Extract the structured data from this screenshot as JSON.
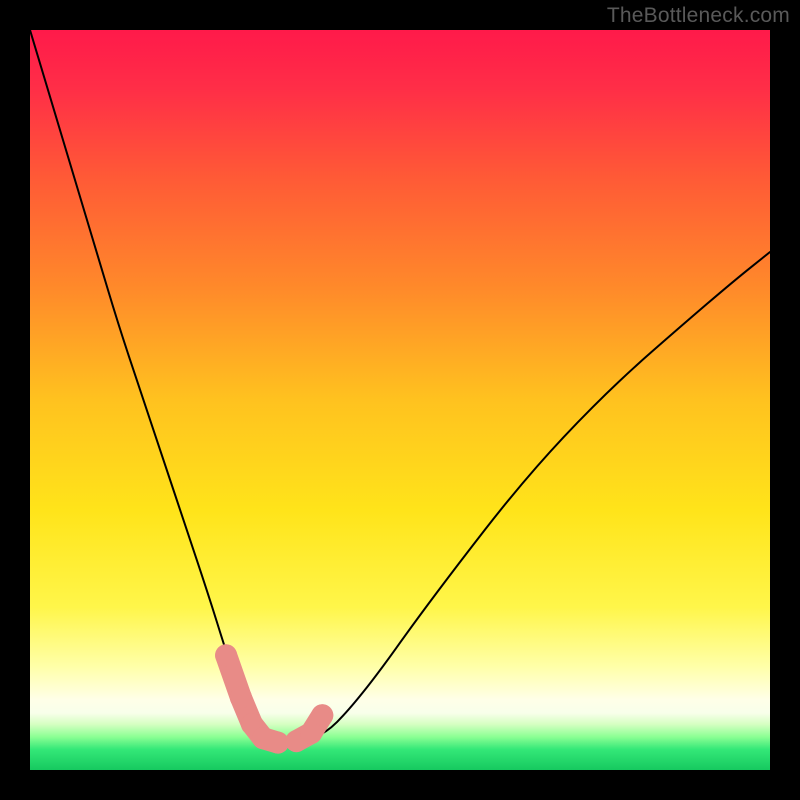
{
  "watermark": "TheBottleneck.com",
  "colors": {
    "frame": "#000000",
    "curve": "#000000",
    "marker_fill": "#e88b87",
    "marker_stroke": "#c76d69",
    "gradient_stops": [
      {
        "offset": 0.0,
        "color": "#ff1a4a"
      },
      {
        "offset": 0.08,
        "color": "#ff2e47"
      },
      {
        "offset": 0.2,
        "color": "#ff5a36"
      },
      {
        "offset": 0.35,
        "color": "#ff8a2a"
      },
      {
        "offset": 0.5,
        "color": "#ffc21f"
      },
      {
        "offset": 0.65,
        "color": "#ffe41a"
      },
      {
        "offset": 0.78,
        "color": "#fff64a"
      },
      {
        "offset": 0.86,
        "color": "#ffffa8"
      },
      {
        "offset": 0.905,
        "color": "#ffffe8"
      },
      {
        "offset": 0.923,
        "color": "#f8ffea"
      },
      {
        "offset": 0.938,
        "color": "#d6ffc2"
      },
      {
        "offset": 0.955,
        "color": "#8cff94"
      },
      {
        "offset": 0.972,
        "color": "#34e878"
      },
      {
        "offset": 1.0,
        "color": "#16c95f"
      }
    ]
  },
  "chart_data": {
    "type": "line",
    "title": "",
    "xlabel": "",
    "ylabel": "",
    "xlim": [
      0,
      100
    ],
    "ylim": [
      0,
      100
    ],
    "note": "x is horizontal position (0–100 across plot), y is bottleneck % (0 = bottom/green, 100 = top/red). Values read from pixel positions.",
    "series": [
      {
        "name": "bottleneck-curve",
        "x": [
          0,
          3,
          6,
          9,
          12,
          15,
          18,
          21,
          24,
          26.5,
          28.5,
          30,
          31.5,
          33.5,
          37,
          40,
          43,
          47,
          52,
          58,
          65,
          72,
          80,
          88,
          95,
          100
        ],
        "y": [
          100,
          90,
          80,
          70,
          60,
          51,
          42,
          33,
          24,
          16,
          10,
          6,
          4,
          4,
          4,
          5,
          8,
          13,
          20,
          28,
          37,
          45,
          53,
          60,
          66,
          70
        ]
      }
    ],
    "markers": {
      "name": "highlighted-segment",
      "style": "sausage",
      "points_x": [
        26.5,
        28.5,
        30.0,
        31.5,
        33.5,
        36.0,
        38.0,
        39.5
      ],
      "points_y": [
        15.5,
        9.8,
        6.2,
        4.3,
        3.7,
        3.9,
        5.0,
        7.4
      ]
    }
  }
}
